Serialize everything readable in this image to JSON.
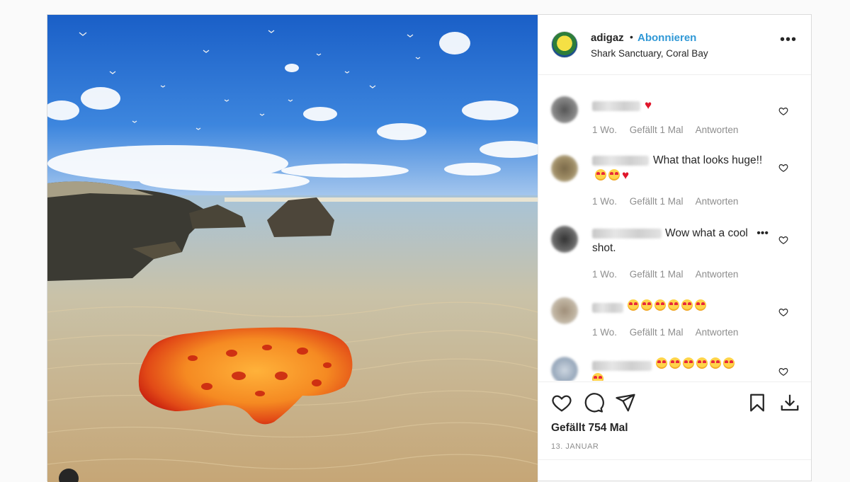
{
  "post": {
    "username": "adigaz",
    "separator": "•",
    "follow_label": "Abonnieren",
    "location": "Shark Sanctuary, Coral Bay",
    "more_label": "•••",
    "likes_text": "Gefällt 754 Mal",
    "date_text": "13. JANUAR"
  },
  "comments": [
    {
      "text": "",
      "heart": "♥",
      "age": "1 Wo.",
      "likes": "Gefällt 1 Mal",
      "reply": "Antworten"
    },
    {
      "text": "What that looks huge!!",
      "heart": "♥",
      "age": "1 Wo.",
      "likes": "Gefällt 1 Mal",
      "reply": "Antworten"
    },
    {
      "text": "Wow what a cool shot.",
      "more": "•••",
      "age": "1 Wo.",
      "likes": "Gefällt 1 Mal",
      "reply": "Antworten"
    },
    {
      "text": "",
      "age": "1 Wo.",
      "likes": "Gefällt 1 Mal",
      "reply": "Antworten"
    },
    {
      "text": ""
    }
  ],
  "icons": {
    "like": "heart-outline-icon",
    "comment": "speech-bubble-icon",
    "share": "paper-plane-icon",
    "save": "bookmark-icon",
    "download": "download-icon"
  },
  "colors": {
    "link": "#2f98d6",
    "heart": "#e0162b",
    "meta": "#8e8e8e"
  }
}
